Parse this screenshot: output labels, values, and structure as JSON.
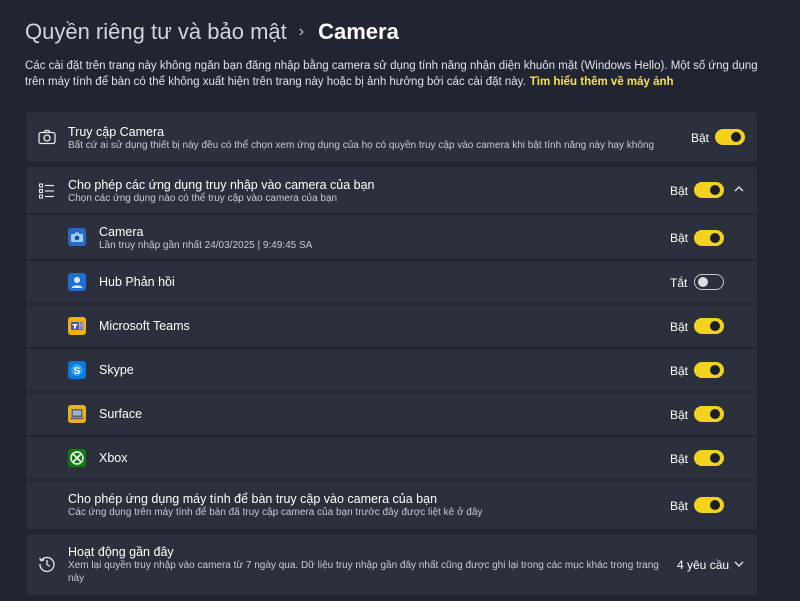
{
  "breadcrumb": {
    "parent": "Quyền riêng tư và bảo mật",
    "separator": "›",
    "current": "Camera"
  },
  "description": {
    "text": "Các cài đặt trên trang này không ngăn bạn đăng nhập bằng camera sử dụng tính năng nhận diện khuôn mặt (Windows Hello). Một số ứng dụng trên máy tính để bàn có thể không xuất hiện trên trang này hoặc bị ảnh hưởng bởi các cài đặt này.",
    "link": "Tìm hiểu thêm về máy ảnh"
  },
  "camera_access": {
    "title": "Truy cập Camera",
    "subtitle": "Bất cứ ai sử dụng thiết bị này đều có thể chọn xem ứng dụng của họ có quyền truy cập vào camera khi bật tính năng này hay không",
    "state": "Bật",
    "on": true
  },
  "app_access": {
    "title": "Cho phép các ứng dụng truy nhập vào camera của bạn",
    "subtitle": "Chọn các ứng dụng nào có thể truy cập vào camera của bạn",
    "state": "Bật",
    "on": true
  },
  "apps": [
    {
      "name": "Camera",
      "detail": "Lần truy nhập gần nhất 24/03/2025  |  9:49:45 SA",
      "state": "Bật",
      "on": true,
      "icon": "camera-app-icon"
    },
    {
      "name": "Hub Phản hồi",
      "detail": "",
      "state": "Tắt",
      "on": false,
      "icon": "feedback-hub-icon"
    },
    {
      "name": "Microsoft Teams",
      "detail": "",
      "state": "Bật",
      "on": true,
      "icon": "teams-icon"
    },
    {
      "name": "Skype",
      "detail": "",
      "state": "Bật",
      "on": true,
      "icon": "skype-icon"
    },
    {
      "name": "Surface",
      "detail": "",
      "state": "Bật",
      "on": true,
      "icon": "surface-icon"
    },
    {
      "name": "Xbox",
      "detail": "",
      "state": "Bật",
      "on": true,
      "icon": "xbox-icon"
    }
  ],
  "desktop_access": {
    "title": "Cho phép ứng dụng máy tính để bàn truy cập vào camera của bạn",
    "subtitle": "Các ứng dụng trên máy tính để bàn đã truy cập camera của bạn trước đây được liệt kê ở đây",
    "state": "Bật",
    "on": true
  },
  "recent_activity": {
    "title": "Hoạt động gần đây",
    "subtitle_line1": "Xem lại quyền truy nhập vào camera từ 7 ngày qua. Dữ liệu truy nhập gần đây nhất cũng được ghi lại trong các mục khác trong trang",
    "subtitle_line2": "này",
    "count": "4 yêu cầu"
  },
  "colors": {
    "background": "#202531",
    "card": "#2b303c",
    "accent": "#f3d21d",
    "link": "#f5e14a"
  }
}
